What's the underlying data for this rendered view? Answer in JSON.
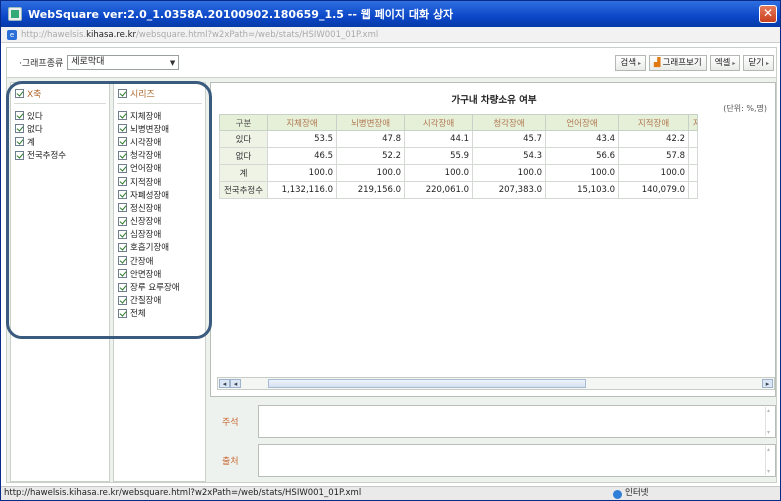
{
  "window": {
    "title": "WebSquare ver:2.0_1.0358A.20100902.180659_1.5 -- 웹 페이지 대화 상자",
    "close_glyph": "✕"
  },
  "address": {
    "prefix": "http://hawelsis.",
    "host": "kihasa.re.kr",
    "path": "/websquare.html?w2xPath=/web/stats/HSIW001_01P.xml"
  },
  "toolbar": {
    "graph_type_label": "·그래프종류",
    "graph_type_value": "세로막대",
    "search_label": "검색",
    "graph_view_label": "그래프보기",
    "excel_label": "엑셀",
    "close_label": "닫기"
  },
  "x_axis_panel": {
    "header": "X축",
    "items": [
      "있다",
      "없다",
      "계",
      "전국추정수"
    ]
  },
  "series_panel": {
    "header": "시리즈",
    "items": [
      "지체장애",
      "뇌병변장애",
      "시각장애",
      "청각장애",
      "언어장애",
      "지적장애",
      "자폐성장애",
      "정신장애",
      "신장장애",
      "심장장애",
      "호흡기장애",
      "간장애",
      "안면장애",
      "장루 요루장애",
      "간질장애",
      "전체"
    ]
  },
  "grid": {
    "title": "가구내 차량소유 여부",
    "unit": "(단위: %,명)",
    "corner": "구분",
    "columns": [
      "지체장애",
      "뇌병변장애",
      "시각장애",
      "청각장애",
      "언어장애",
      "지적장애",
      "자"
    ],
    "rows": [
      {
        "label": "있다",
        "values": [
          "53.5",
          "47.8",
          "44.1",
          "45.7",
          "43.4",
          "42.2"
        ]
      },
      {
        "label": "없다",
        "values": [
          "46.5",
          "52.2",
          "55.9",
          "54.3",
          "56.6",
          "57.8"
        ]
      },
      {
        "label": "계",
        "values": [
          "100.0",
          "100.0",
          "100.0",
          "100.0",
          "100.0",
          "100.0"
        ]
      },
      {
        "label": "전국추정수",
        "values": [
          "1,132,116.0",
          "219,156.0",
          "220,061.0",
          "207,383.0",
          "15,103.0",
          "140,079.0"
        ]
      }
    ]
  },
  "notes": {
    "comment_label": "주석",
    "source_label": "출처"
  },
  "statusbar": {
    "url": "http://hawelsis.kihasa.re.kr/websquare.html?w2xPath=/web/stats/HSIW001_01P.xml",
    "zone": "인터넷"
  },
  "colors": {
    "titlebar": "#0b47c8",
    "header_bg": "#e6efd8",
    "highlight_ring": "#3a5b7e"
  }
}
